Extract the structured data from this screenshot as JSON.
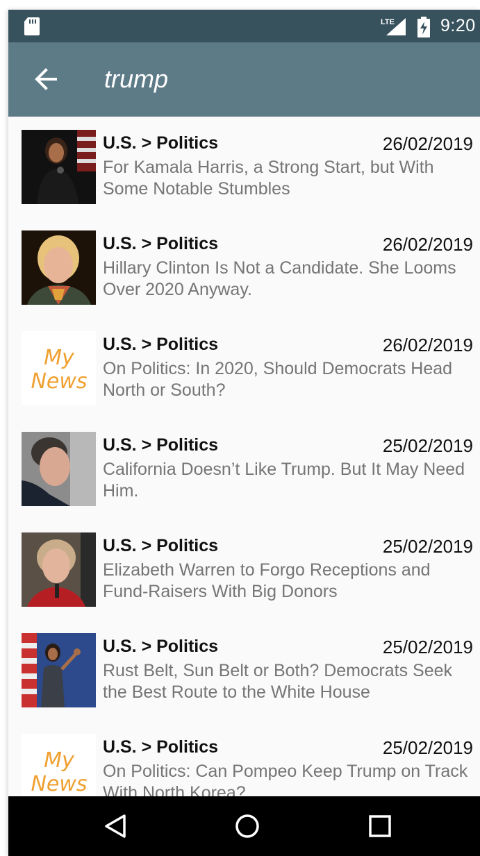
{
  "status_bar": {
    "time": "9:20",
    "network_label": "LTE",
    "icons": [
      "sd-card-icon",
      "lte-signal-icon",
      "battery-charging-icon"
    ]
  },
  "toolbar": {
    "back_icon": "arrow-back-icon",
    "title": "trump"
  },
  "colors": {
    "status_bar": "#37525d",
    "toolbar": "#5d7b87",
    "list_bg": "#fafafa",
    "headline_text": "#757575",
    "mynews_logo": "#f0a030"
  },
  "news": [
    {
      "section": "U.S. > Politics",
      "date": "26/02/2019",
      "headline": "For Kamala Harris, a Strong Start, but With Some Notable Stumbles",
      "thumb": "photo"
    },
    {
      "section": "U.S. > Politics",
      "date": "26/02/2019",
      "headline": "Hillary Clinton Is Not a Candidate. She Looms Over 2020 Anyway.",
      "thumb": "photo"
    },
    {
      "section": "U.S. > Politics",
      "date": "26/02/2019",
      "headline": "On Politics: In 2020, Should Democrats Head North or South?",
      "thumb": "logo",
      "logo_line1": "My",
      "logo_line2": "News"
    },
    {
      "section": "U.S. > Politics",
      "date": "25/02/2019",
      "headline": "California Doesn’t Like Trump. But It May Need Him.",
      "thumb": "photo"
    },
    {
      "section": "U.S. > Politics",
      "date": "25/02/2019",
      "headline": "Elizabeth Warren to Forgo Receptions and Fund-Raisers With Big Donors",
      "thumb": "photo"
    },
    {
      "section": "U.S. > Politics",
      "date": "25/02/2019",
      "headline": "Rust Belt, Sun Belt or Both? Democrats Seek the Best Route to the White House",
      "thumb": "photo"
    },
    {
      "section": "U.S. > Politics",
      "date": "25/02/2019",
      "headline": "On Politics: Can Pompeo Keep Trump on Track With North Korea?",
      "thumb": "logo",
      "logo_line1": "My",
      "logo_line2": "News"
    }
  ],
  "nav_bar": {
    "buttons": [
      "back-triangle-icon",
      "home-circle-icon",
      "recents-square-icon"
    ]
  }
}
